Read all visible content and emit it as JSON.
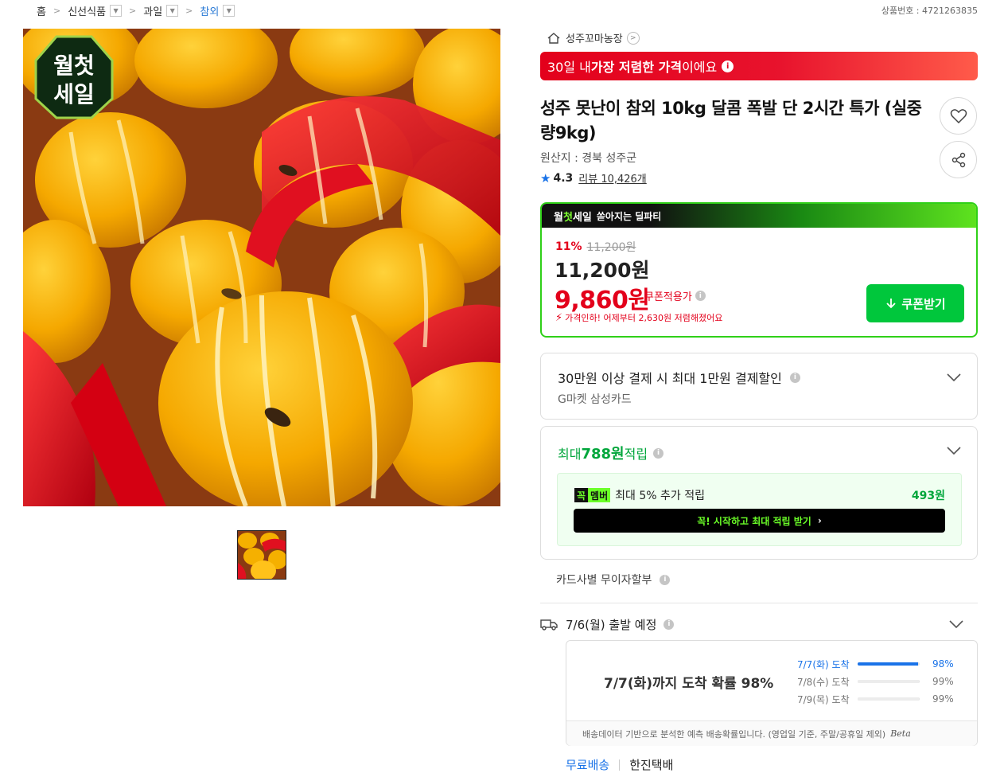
{
  "breadcrumb": {
    "home": "홈",
    "items": [
      {
        "label": "신선식품"
      },
      {
        "label": "과일"
      },
      {
        "label": "참외"
      }
    ]
  },
  "product_number": "상품번호 : 4721263835",
  "image_badge": {
    "line1": "월첫",
    "line2": "세일"
  },
  "store": {
    "name": "성주꼬마농장"
  },
  "banner": {
    "prefix": "30일 내 ",
    "bold": "가장 저렴한 가격",
    "suffix": "이에요"
  },
  "product": {
    "title": "성주 못난이 참외 10kg 달콤 폭발 단 2시간 특가 (실중량9kg)",
    "origin": "원산지 : 경북 성주군",
    "rating": "4.3",
    "review": "리뷰 10,426개"
  },
  "deal": {
    "head_part1": "월",
    "head_part2": "첫",
    "head_part3": "세일",
    "head_tail": "쏟아지는 딜파티",
    "discount_pct": "11%",
    "original_price": "11,200원",
    "sale_price": "11,200원",
    "coupon_price": "9,860원",
    "coupon_label": "쿠폰적용가",
    "price_drop_note": "가격인하! 어제부터 2,630원 저렴해졌어요",
    "coupon_button": "쿠폰받기"
  },
  "card_benefit": {
    "title": "30만원 이상 결제 시 최대 1만원 결제할인",
    "subtitle": "G마켓 삼성카드"
  },
  "points": {
    "prefix": "최대 ",
    "amount": "788원",
    "suffix": " 적립",
    "member_badge_1": "꼭",
    "member_badge_2": "멤버",
    "member_text": "최대 5% 추가 적립",
    "member_points": "493원",
    "member_button": "꼭! 시작하고 최대 적립 받기"
  },
  "installment": "카드사별 무이자할부",
  "shipping": {
    "departure": "7/6(월) 출발 예정",
    "main": "7/7(화)까지 도착 확률 98%",
    "rows": [
      {
        "label": "7/7(화) 도착",
        "pct": "98%",
        "value": 0.98
      },
      {
        "label": "7/8(수) 도착",
        "pct": "99%",
        "value": 0.99
      },
      {
        "label": "7/9(목) 도착",
        "pct": "99%",
        "value": 0.99
      }
    ],
    "footnote": "배송데이터 기반으로 분석한 예측 배송확률입니다. (영업일 기준, 주말/공휴일 제외)",
    "beta": "Beta",
    "free": "무료배송",
    "carrier": "한진택배"
  },
  "colors": {
    "accent_red": "#e3001b",
    "accent_green": "#00c73c",
    "link_blue": "#1a73e8",
    "member_lime": "#6bff28"
  }
}
